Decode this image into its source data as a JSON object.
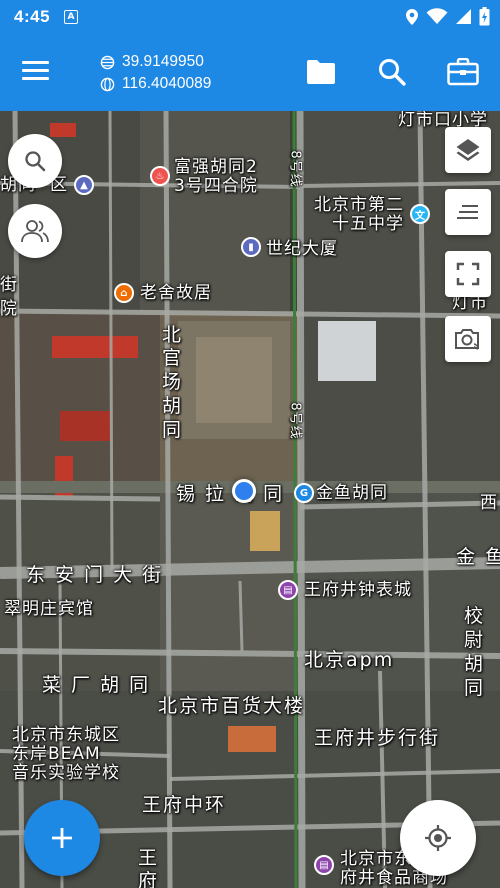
{
  "status_bar": {
    "time": "4:45",
    "badge": "A"
  },
  "toolbar": {
    "latitude": "39.9149950",
    "longitude": "116.4040089"
  },
  "icons": {
    "menu": "menu-icon",
    "folder": "folder-icon",
    "search": "search-icon",
    "toolbox": "toolbox-icon",
    "map_search": "search-icon",
    "users": "users-icon",
    "layers": "layers-icon",
    "list": "list-icon",
    "fullscreen": "fullscreen-icon",
    "camera": "camera-icon",
    "add": "plus-icon",
    "locate": "crosshair-icon"
  },
  "map": {
    "labels": {
      "denshi": "灯市口小学",
      "hutong_area": "胡同",
      "qu": "区",
      "fuqiang": "富强胡同2",
      "fuqiang2": "3号四合院",
      "route8_top": "8号线",
      "school25a": "北京市第二",
      "school25b": "十五中学",
      "centurybuilding": "世纪大厦",
      "jie": "街",
      "yuan": "院",
      "laoshe": "老舍故居",
      "dengshi": "灯市",
      "beiguan": "北",
      "beiguan2": "官",
      "beiguan3": "场",
      "beiguan4": "胡",
      "beiguan5": "同",
      "route8_mid": "8号线",
      "xila": "锡 拉 胡 同",
      "jinyu": "金鱼胡同",
      "xi": "西",
      "jinyu2": "金 鱼",
      "donganmen": "东 安 门 大 街",
      "zhongbiao": "王府井钟表城",
      "cuiming": "翠明庄宾馆",
      "xiao": "校",
      "wei": "尉",
      "hu": "胡",
      "tong": "同",
      "apm": "北京apm",
      "caichang": "菜 厂 胡 同",
      "baihuo": "北京市百货大楼",
      "dongcheng1": "北京市东城区",
      "dongcheng2": "东岸BEAM",
      "dongcheng3": "音乐实验学校",
      "buxingjie": "王府井步行街",
      "zhonghuan": "王府中环",
      "wang": "王",
      "fu": "府",
      "food1": "北京市东",
      "food2": "府井食品商场"
    }
  },
  "colors": {
    "primary": "#1e88e5",
    "location_dot": "#2f80ed"
  }
}
